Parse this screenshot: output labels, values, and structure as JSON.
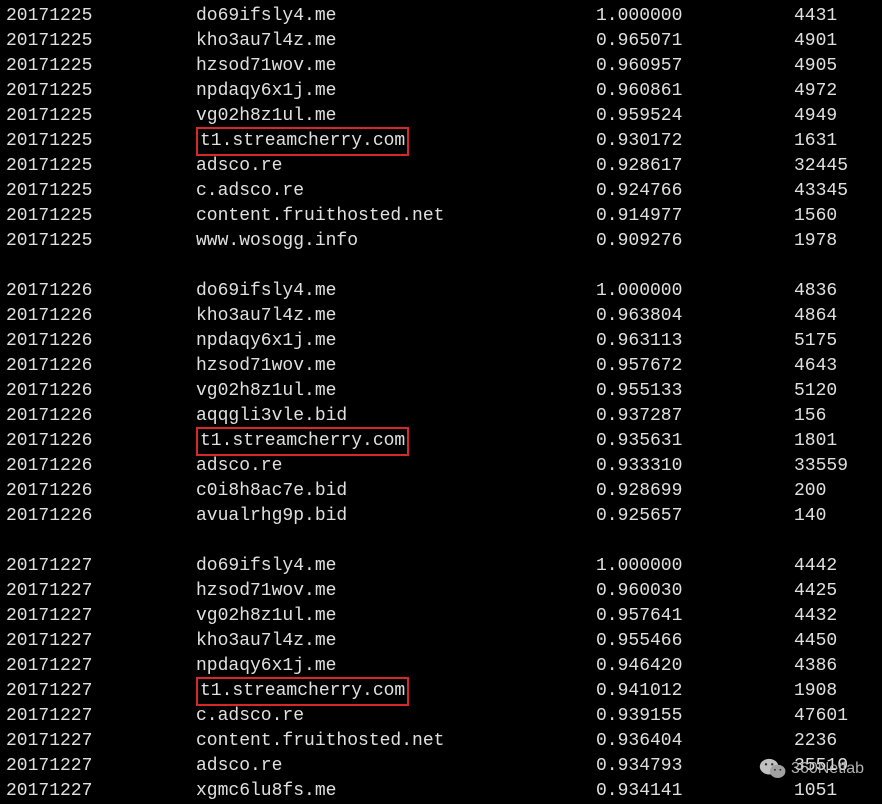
{
  "watermark": "360Netlab",
  "groups": [
    {
      "rows": [
        {
          "date": "20171225",
          "domain": "do69ifsly4.me",
          "score": "1.000000",
          "count": "4431",
          "highlighted": false
        },
        {
          "date": "20171225",
          "domain": "kho3au7l4z.me",
          "score": "0.965071",
          "count": "4901",
          "highlighted": false
        },
        {
          "date": "20171225",
          "domain": "hzsod71wov.me",
          "score": "0.960957",
          "count": "4905",
          "highlighted": false
        },
        {
          "date": "20171225",
          "domain": "npdaqy6x1j.me",
          "score": "0.960861",
          "count": "4972",
          "highlighted": false
        },
        {
          "date": "20171225",
          "domain": "vg02h8z1ul.me",
          "score": "0.959524",
          "count": "4949",
          "highlighted": false
        },
        {
          "date": "20171225",
          "domain": "t1.streamcherry.com",
          "score": "0.930172",
          "count": "1631",
          "highlighted": true
        },
        {
          "date": "20171225",
          "domain": "adsco.re",
          "score": "0.928617",
          "count": "32445",
          "highlighted": false
        },
        {
          "date": "20171225",
          "domain": "c.adsco.re",
          "score": "0.924766",
          "count": "43345",
          "highlighted": false
        },
        {
          "date": "20171225",
          "domain": "content.fruithosted.net",
          "score": "0.914977",
          "count": "1560",
          "highlighted": false
        },
        {
          "date": "20171225",
          "domain": "www.wosogg.info",
          "score": "0.909276",
          "count": "1978",
          "highlighted": false
        }
      ]
    },
    {
      "rows": [
        {
          "date": "20171226",
          "domain": "do69ifsly4.me",
          "score": "1.000000",
          "count": "4836",
          "highlighted": false
        },
        {
          "date": "20171226",
          "domain": "kho3au7l4z.me",
          "score": "0.963804",
          "count": "4864",
          "highlighted": false
        },
        {
          "date": "20171226",
          "domain": "npdaqy6x1j.me",
          "score": "0.963113",
          "count": "5175",
          "highlighted": false
        },
        {
          "date": "20171226",
          "domain": "hzsod71wov.me",
          "score": "0.957672",
          "count": "4643",
          "highlighted": false
        },
        {
          "date": "20171226",
          "domain": "vg02h8z1ul.me",
          "score": "0.955133",
          "count": "5120",
          "highlighted": false
        },
        {
          "date": "20171226",
          "domain": "aqqgli3vle.bid",
          "score": "0.937287",
          "count": "156",
          "highlighted": false
        },
        {
          "date": "20171226",
          "domain": "t1.streamcherry.com",
          "score": "0.935631",
          "count": "1801",
          "highlighted": true
        },
        {
          "date": "20171226",
          "domain": "adsco.re",
          "score": "0.933310",
          "count": "33559",
          "highlighted": false
        },
        {
          "date": "20171226",
          "domain": "c0i8h8ac7e.bid",
          "score": "0.928699",
          "count": "200",
          "highlighted": false
        },
        {
          "date": "20171226",
          "domain": "avualrhg9p.bid",
          "score": "0.925657",
          "count": "140",
          "highlighted": false
        }
      ]
    },
    {
      "rows": [
        {
          "date": "20171227",
          "domain": "do69ifsly4.me",
          "score": "1.000000",
          "count": "4442",
          "highlighted": false
        },
        {
          "date": "20171227",
          "domain": "hzsod71wov.me",
          "score": "0.960030",
          "count": "4425",
          "highlighted": false
        },
        {
          "date": "20171227",
          "domain": "vg02h8z1ul.me",
          "score": "0.957641",
          "count": "4432",
          "highlighted": false
        },
        {
          "date": "20171227",
          "domain": "kho3au7l4z.me",
          "score": "0.955466",
          "count": "4450",
          "highlighted": false
        },
        {
          "date": "20171227",
          "domain": "npdaqy6x1j.me",
          "score": "0.946420",
          "count": "4386",
          "highlighted": false
        },
        {
          "date": "20171227",
          "domain": "t1.streamcherry.com",
          "score": "0.941012",
          "count": "1908",
          "highlighted": true
        },
        {
          "date": "20171227",
          "domain": "c.adsco.re",
          "score": "0.939155",
          "count": "47601",
          "highlighted": false
        },
        {
          "date": "20171227",
          "domain": "content.fruithosted.net",
          "score": "0.936404",
          "count": "2236",
          "highlighted": false
        },
        {
          "date": "20171227",
          "domain": "adsco.re",
          "score": "0.934793",
          "count": "35510",
          "highlighted": false
        },
        {
          "date": "20171227",
          "domain": "xgmc6lu8fs.me",
          "score": "0.934141",
          "count": "1051",
          "highlighted": false
        }
      ]
    }
  ]
}
